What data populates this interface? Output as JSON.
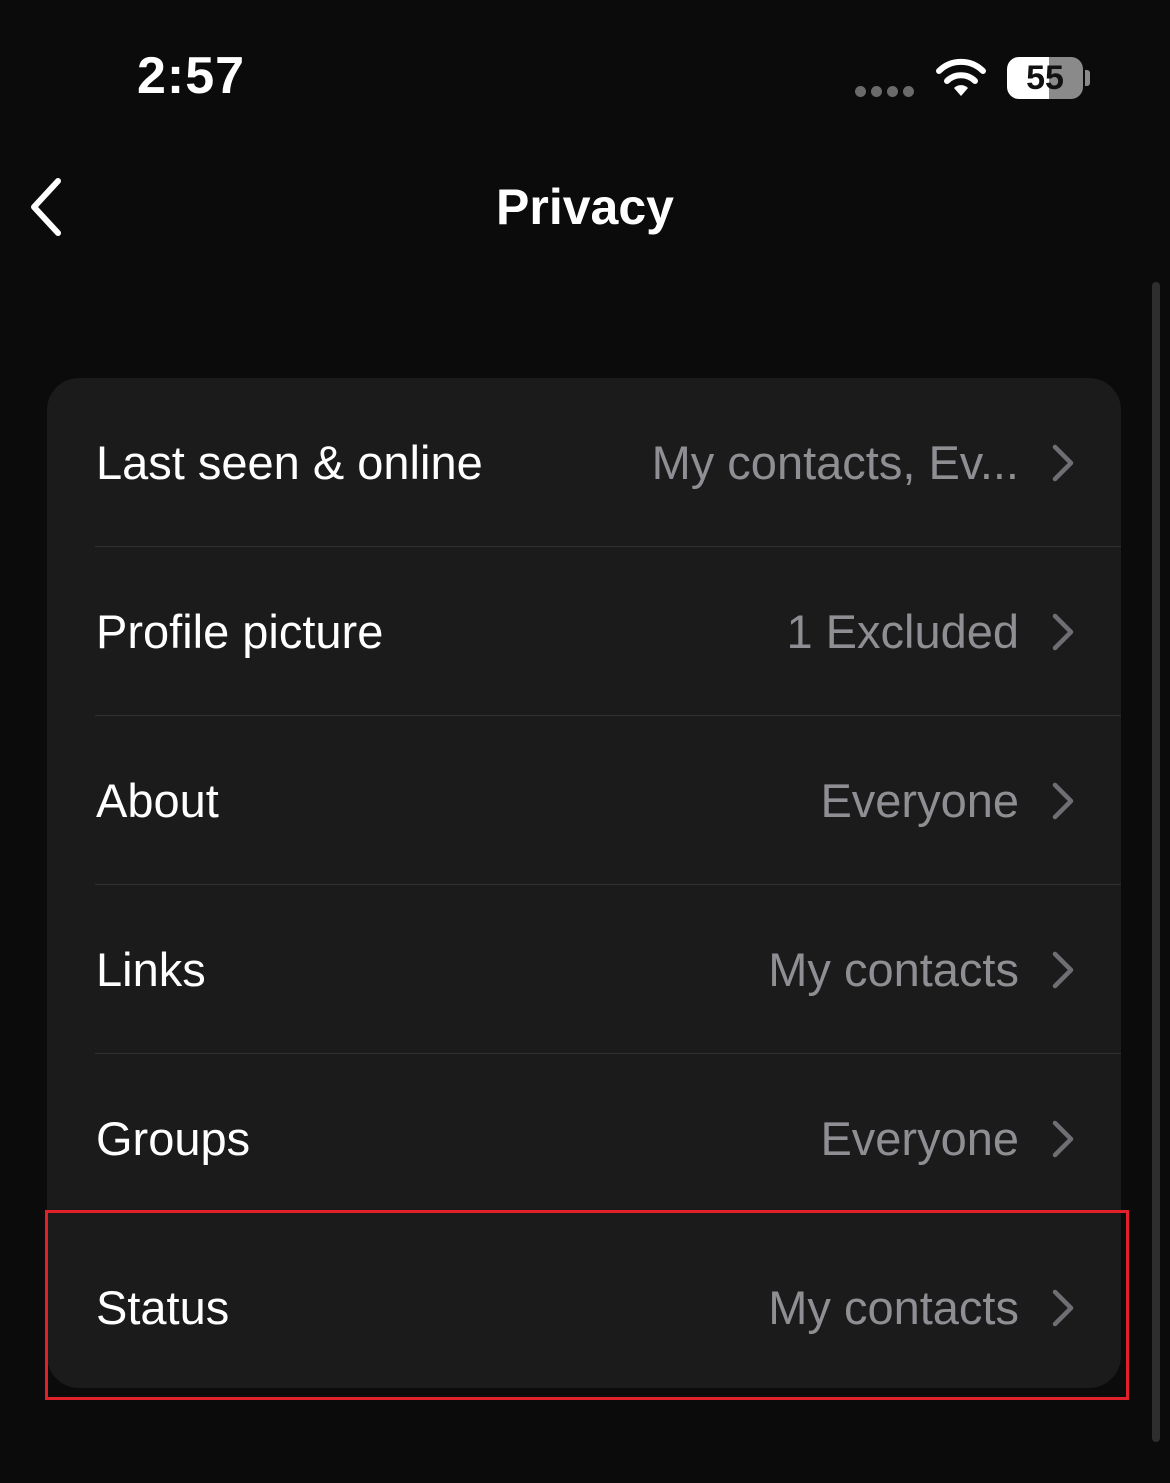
{
  "status_bar": {
    "time": "2:57",
    "battery_level": "55",
    "battery_fraction": 0.55
  },
  "nav": {
    "title": "Privacy",
    "back_icon": "chevron-left-icon"
  },
  "settings": {
    "items": [
      {
        "label": "Last seen & online",
        "value": "My contacts, Ev..."
      },
      {
        "label": "Profile picture",
        "value": "1 Excluded"
      },
      {
        "label": "About",
        "value": "Everyone"
      },
      {
        "label": "Links",
        "value": "My contacts"
      },
      {
        "label": "Groups",
        "value": "Everyone"
      },
      {
        "label": "Status",
        "value": "My contacts"
      }
    ]
  },
  "colors": {
    "background": "#0b0b0b",
    "card": "#1b1b1c",
    "secondary_text": "#8f8f93",
    "highlight": "#e0202a"
  }
}
